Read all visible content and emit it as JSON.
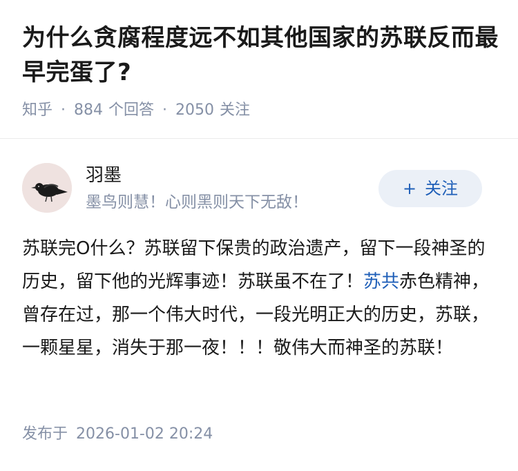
{
  "question": {
    "title": "为什么贪腐程度远不如其他国家的苏联反而最早完蛋了?",
    "source": "知乎",
    "answer_count": "884",
    "answer_label": "个回答",
    "follower_count": "2050",
    "follower_label": "关注"
  },
  "author": {
    "name": "羽墨",
    "bio": "墨鸟则慧！心则黑则天下无敌！",
    "follow_label": "关注",
    "follow_icon": "plus-icon"
  },
  "answer": {
    "text_before_link": "苏联完O什么？苏联留下保贵的政治遗产，留下一段神圣的历史，留下他的光辉事迹！苏联虽不在了！",
    "link_text": "苏共",
    "text_after_link": "赤色精神，曾存在过，那一个伟大时代，一段光明正大的历史，苏联，一颗星星，消失于那一夜！！！敬伟大而神圣的苏联！",
    "link_color": "#1f5fb8"
  },
  "publish": {
    "label": "发布于",
    "time": "2026-01-02 20:24"
  },
  "colors": {
    "meta_gray": "#8590a6",
    "follow_bg": "#ebf0f7",
    "accent_blue": "#1f5fb8"
  }
}
